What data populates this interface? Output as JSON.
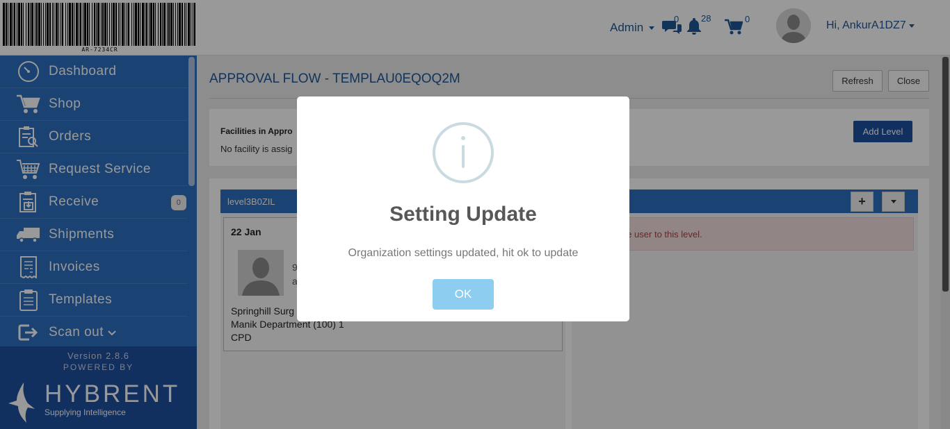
{
  "header": {
    "barcode_text": "AR-7234CR",
    "admin_label": "Admin",
    "messages_count": "0",
    "notifications_count": "28",
    "cart_count": "0",
    "user_greeting": "Hi, AnkurA1DZ7"
  },
  "sidebar": {
    "items": [
      {
        "label": "Dashboard",
        "icon": "dashboard-icon"
      },
      {
        "label": "Shop",
        "icon": "cart-icon"
      },
      {
        "label": "Orders",
        "icon": "orders-icon"
      },
      {
        "label": "Request Service",
        "icon": "request-service-icon"
      },
      {
        "label": "Receive",
        "icon": "receive-icon",
        "badge": "0"
      },
      {
        "label": "Shipments",
        "icon": "truck-icon"
      },
      {
        "label": "Invoices",
        "icon": "invoice-icon"
      },
      {
        "label": "Templates",
        "icon": "clipboard-icon"
      },
      {
        "label": "Scan out",
        "icon": "scan-out-icon"
      }
    ],
    "version": "Version 2.8.6",
    "powered_by": "POWERED BY",
    "logo_name": "HYBRENT",
    "logo_tagline": "Supplying Intelligence"
  },
  "main": {
    "title": "APPROVAL FLOW - TEMPLAU0EQOQ2M",
    "refresh_label": "Refresh",
    "close_label": "Close",
    "facilities_title": "Facilities in Appro",
    "facilities_empty": "No facility is assig",
    "add_level_label": "Add Level",
    "level_name": "level3B0ZIL",
    "add_user_symbol": "+",
    "card": {
      "date": "22 Jan",
      "frag1": "9",
      "frag2": "a",
      "line1": "Springhill Surg",
      "line2": "Manik Department (100) 1",
      "line3": "CPD"
    },
    "alert_text": "d atleast one user to this level."
  },
  "modal": {
    "icon": "info-icon",
    "title": "Setting Update",
    "text": "Organization settings updated, hit ok to update",
    "ok_label": "OK"
  },
  "colors": {
    "brand_blue": "#2c6fc0",
    "dark_blue": "#1d4f9f",
    "ok_button": "#8ccdf0",
    "alert_bg": "#f2dede"
  }
}
